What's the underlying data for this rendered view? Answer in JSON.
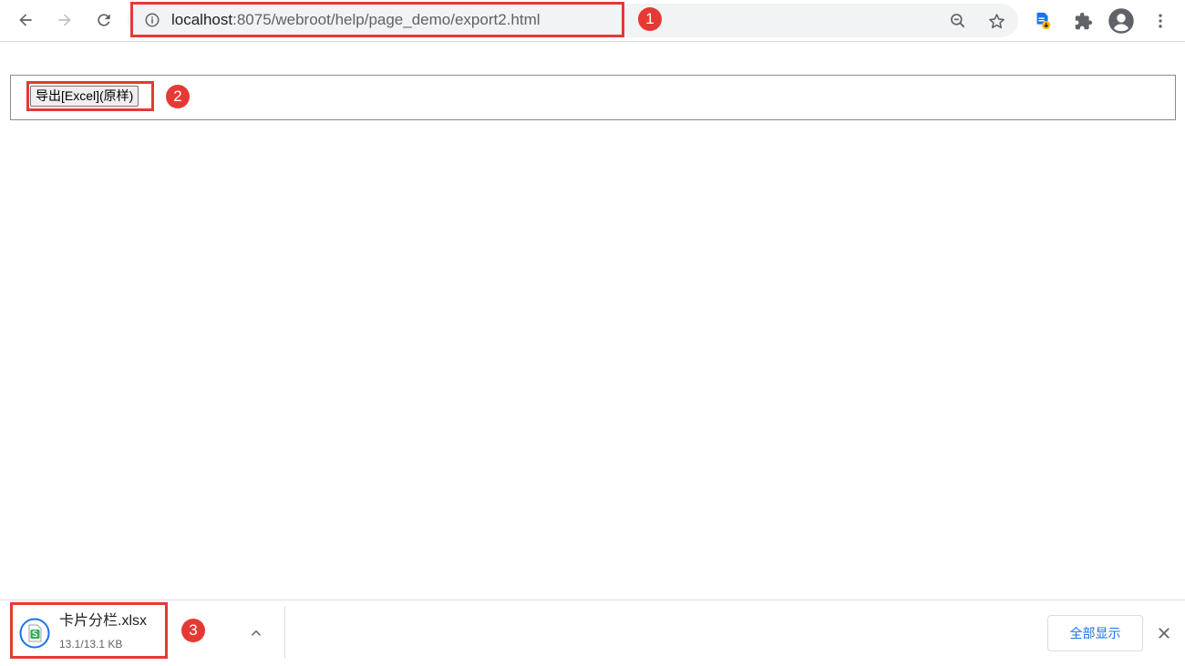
{
  "browser": {
    "url_host": "localhost",
    "url_path": ":8075/webroot/help/page_demo/export2.html"
  },
  "page": {
    "export_button_label": "导出[Excel](原样)"
  },
  "downloads": {
    "file_name": "卡片分栏.xlsx",
    "file_size": "13.1/13.1 KB",
    "show_all_label": "全部显示"
  },
  "annotations": {
    "badge_1": "1",
    "badge_2": "2",
    "badge_3": "3"
  },
  "colors": {
    "annotation_red": "#e53935",
    "link_blue": "#1a73e8",
    "omnibox_bg": "#f1f3f4"
  }
}
